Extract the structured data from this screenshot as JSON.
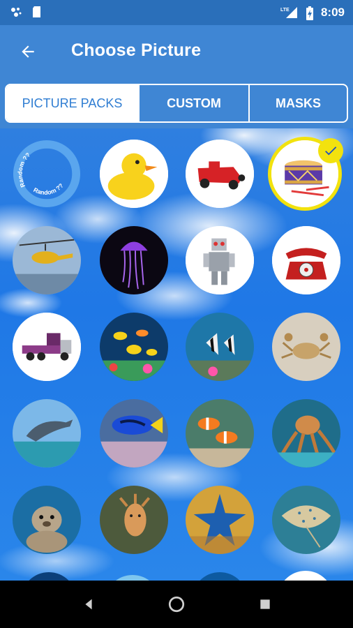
{
  "status_bar": {
    "time": "8:09",
    "network": "LTE"
  },
  "app_bar": {
    "title": "Choose Picture"
  },
  "tabs": [
    {
      "label": "PICTURE PACKS",
      "active": true
    },
    {
      "label": "CUSTOM",
      "active": false
    },
    {
      "label": "MASKS",
      "active": false
    }
  ],
  "tiles": [
    {
      "name": "random",
      "label": "Random ??"
    },
    {
      "name": "rubber-duck"
    },
    {
      "name": "toy-car"
    },
    {
      "name": "toy-drum",
      "selected": true
    },
    {
      "name": "helicopter"
    },
    {
      "name": "jellyfish"
    },
    {
      "name": "toy-robot"
    },
    {
      "name": "red-telephone"
    },
    {
      "name": "purple-truck"
    },
    {
      "name": "tropical-fish"
    },
    {
      "name": "striped-fish"
    },
    {
      "name": "crab"
    },
    {
      "name": "dolphin"
    },
    {
      "name": "blue-tang"
    },
    {
      "name": "clownfish"
    },
    {
      "name": "octopus"
    },
    {
      "name": "seal"
    },
    {
      "name": "cuttlefish"
    },
    {
      "name": "starfish"
    },
    {
      "name": "stingray"
    }
  ],
  "colors": {
    "accent": "#3f86d4",
    "status_bar": "#2a6fba",
    "selected_ring": "#f2e20e"
  }
}
